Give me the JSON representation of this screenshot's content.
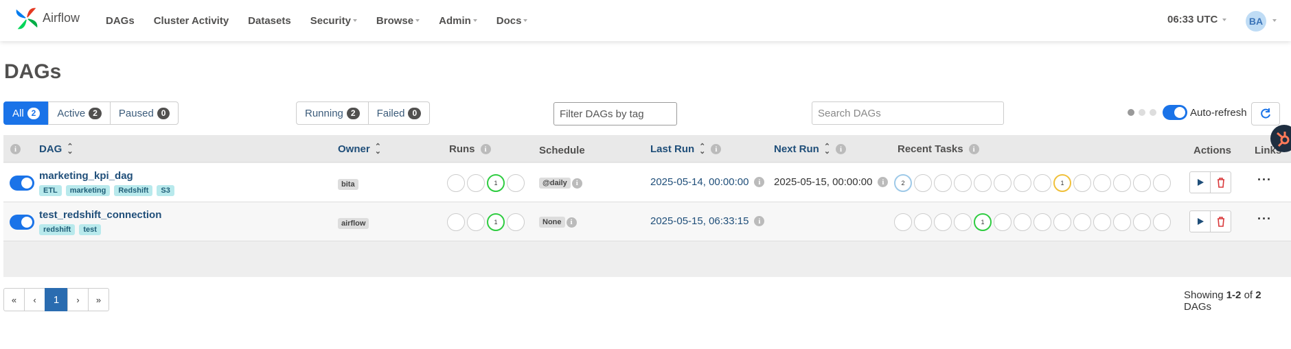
{
  "app": {
    "name": "Airflow"
  },
  "nav": {
    "items": [
      {
        "label": "DAGs",
        "dropdown": false
      },
      {
        "label": "Cluster Activity",
        "dropdown": false
      },
      {
        "label": "Datasets",
        "dropdown": false
      },
      {
        "label": "Security",
        "dropdown": true
      },
      {
        "label": "Browse",
        "dropdown": true
      },
      {
        "label": "Admin",
        "dropdown": true
      },
      {
        "label": "Docs",
        "dropdown": true
      }
    ],
    "clock": "06:33 UTC",
    "user_initials": "BA"
  },
  "page": {
    "title": "DAGs"
  },
  "filters": {
    "status": [
      {
        "label": "All",
        "count": "2",
        "active": true
      },
      {
        "label": "Active",
        "count": "2",
        "active": false
      },
      {
        "label": "Paused",
        "count": "0",
        "active": false
      }
    ],
    "run_state": [
      {
        "label": "Running",
        "count": "2"
      },
      {
        "label": "Failed",
        "count": "0"
      }
    ],
    "tag_placeholder": "Filter DAGs by tag",
    "search_placeholder": "Search DAGs",
    "auto_refresh_label": "Auto-refresh"
  },
  "table": {
    "headers": {
      "dag": "DAG",
      "owner": "Owner",
      "runs": "Runs",
      "schedule": "Schedule",
      "last_run": "Last Run",
      "next_run": "Next Run",
      "recent_tasks": "Recent Tasks",
      "actions": "Actions",
      "links": "Links"
    },
    "rows": [
      {
        "name": "marketing_kpi_dag",
        "tags": [
          "ETL",
          "marketing",
          "Redshift",
          "S3"
        ],
        "owner": "bita",
        "runs": [
          "",
          "",
          "1",
          ""
        ],
        "runs_states": [
          "none",
          "none",
          "success",
          "none"
        ],
        "schedule": "@daily",
        "last_run": "2025-05-14, 00:00:00",
        "next_run": "2025-05-15, 00:00:00",
        "tasks": [
          "2",
          "",
          "",
          "",
          "",
          "",
          "",
          "",
          "1",
          "",
          "",
          "",
          "",
          ""
        ],
        "tasks_states": [
          "queued",
          "none",
          "none",
          "none",
          "none",
          "none",
          "none",
          "none",
          "upstream",
          "none",
          "none",
          "none",
          "none",
          "none"
        ]
      },
      {
        "name": "test_redshift_connection",
        "tags": [
          "redshift",
          "test"
        ],
        "owner": "airflow",
        "runs": [
          "",
          "",
          "1",
          ""
        ],
        "runs_states": [
          "none",
          "none",
          "success",
          "none"
        ],
        "schedule": "None",
        "last_run": "2025-05-15, 06:33:15",
        "next_run": "",
        "tasks": [
          "",
          "",
          "",
          "",
          "1",
          "",
          "",
          "",
          "",
          "",
          "",
          "",
          "",
          ""
        ],
        "tasks_states": [
          "none",
          "none",
          "none",
          "none",
          "success",
          "none",
          "none",
          "none",
          "none",
          "none",
          "none",
          "none",
          "none",
          "none"
        ]
      }
    ]
  },
  "pagination": {
    "first": "«",
    "prev": "‹",
    "current": "1",
    "next": "›",
    "last": "»",
    "showing_prefix": "Showing",
    "showing_range": "1-2",
    "showing_of": "of",
    "showing_total": "2",
    "showing_suffix": "DAGs"
  },
  "colors": {
    "primary": "#1a73e8",
    "success": "#2ecc40",
    "queued": "#9ec9e8",
    "upstream": "#f0c03a",
    "link": "#1f4e79"
  }
}
